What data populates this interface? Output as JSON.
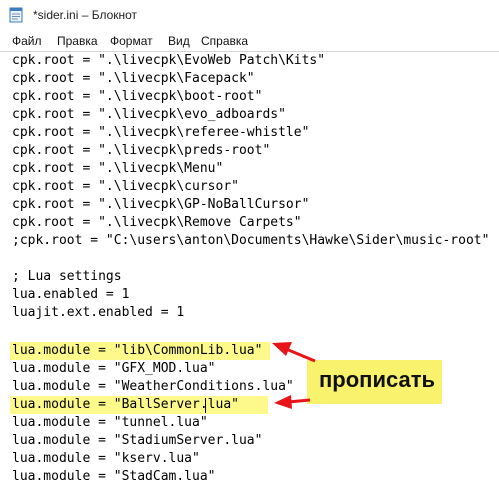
{
  "window": {
    "title": "*sider.ini – Блокнот"
  },
  "menubar": {
    "items": [
      "Файл",
      "Правка",
      "Формат",
      "Вид",
      "Справка"
    ]
  },
  "editor": {
    "lines": [
      "cpk.root = \".\\livecpk\\EvoWeb Patch\\Kits\"",
      "cpk.root = \".\\livecpk\\Facepack\"",
      "cpk.root = \".\\livecpk\\boot-root\"",
      "cpk.root = \".\\livecpk\\evo_adboards\"",
      "cpk.root = \".\\livecpk\\referee-whistle\"",
      "cpk.root = \".\\livecpk\\preds-root\"",
      "cpk.root = \".\\livecpk\\Menu\"",
      "cpk.root = \".\\livecpk\\cursor\"",
      "cpk.root = \".\\livecpk\\GP-NoBallCursor\"",
      "cpk.root = \".\\livecpk\\Remove Carpets\"",
      ";cpk.root = \"C:\\users\\anton\\Documents\\Hawke\\Sider\\music-root\"",
      "",
      "; Lua settings",
      "lua.enabled = 1",
      "luajit.ext.enabled = 1",
      "",
      "lua.module = \"lib\\CommonLib.lua\"",
      "lua.module = \"GFX_MOD.lua\"",
      "lua.module = \"WeatherConditions.lua\"",
      "lua.module = \"BallServer.lua\"",
      "lua.module = \"tunnel.lua\"",
      "lua.module = \"StadiumServer.lua\"",
      "lua.module = \"kserv.lua\"",
      "lua.module = \"StadCam.lua\""
    ]
  },
  "annotation": {
    "label": "прописать",
    "color": "#f8f26c",
    "arrow_color": "#e8141a"
  },
  "highlight_color": "#fdf98a"
}
